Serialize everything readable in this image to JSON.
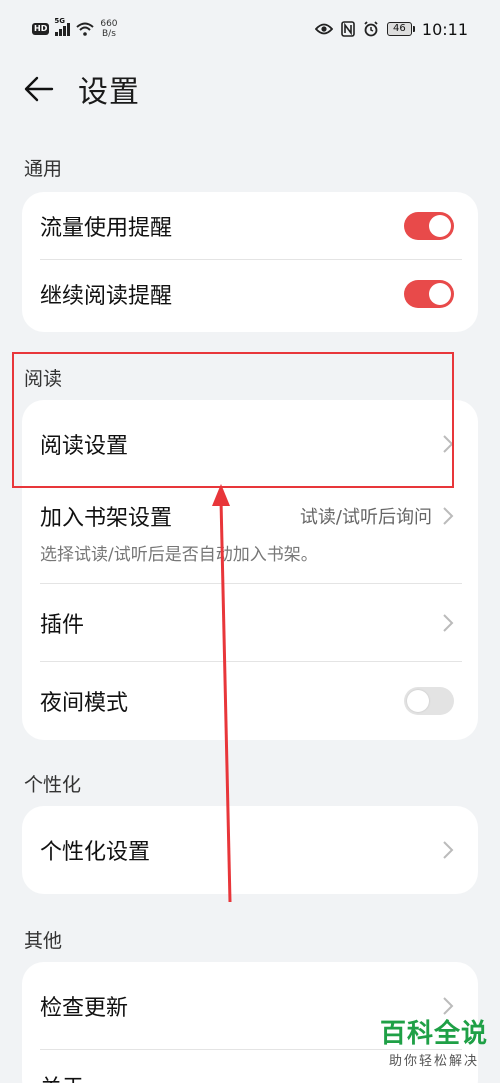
{
  "status_bar": {
    "hd": "HD",
    "network_gen": "5G",
    "speed_value": "660",
    "speed_unit": "B/s",
    "battery": "46",
    "time": "10:11",
    "icons": [
      "eye-icon",
      "nfc-icon",
      "alarm-icon"
    ]
  },
  "header": {
    "title": "设置"
  },
  "sections": {
    "general": {
      "title": "通用",
      "items": [
        {
          "label": "流量使用提醒",
          "toggle": true
        },
        {
          "label": "继续阅读提醒",
          "toggle": true
        }
      ]
    },
    "reading": {
      "title": "阅读",
      "items": [
        {
          "label": "阅读设置"
        },
        {
          "label": "加入书架设置",
          "value": "试读/试听后询问",
          "subtitle": "选择试读/试听后是否自动加入书架。"
        },
        {
          "label": "插件"
        },
        {
          "label": "夜间模式",
          "toggle": false
        }
      ]
    },
    "personal": {
      "title": "个性化",
      "items": [
        {
          "label": "个性化设置"
        }
      ]
    },
    "other": {
      "title": "其他",
      "items": [
        {
          "label": "检查更新"
        },
        {
          "label": "关于"
        }
      ]
    }
  },
  "watermark": {
    "main": "百科全说",
    "sub": "助你轻松解决"
  },
  "colors": {
    "accent": "#e84a4a",
    "annotation": "#e8363a",
    "watermark": "#1fa046"
  }
}
